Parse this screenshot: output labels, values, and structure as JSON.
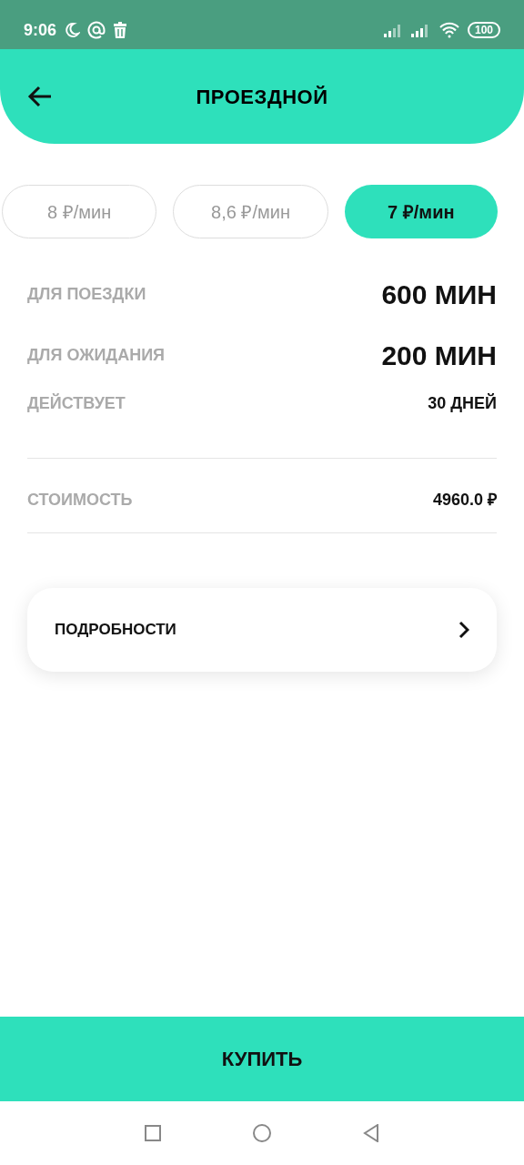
{
  "status_bar": {
    "time": "9:06",
    "battery": "100"
  },
  "header": {
    "title": "ПРОЕЗДНОЙ"
  },
  "tariffs": [
    {
      "label": "8 ₽/мин",
      "selected": false
    },
    {
      "label": "8,6 ₽/мин",
      "selected": false
    },
    {
      "label": "7 ₽/мин",
      "selected": true
    }
  ],
  "details": [
    {
      "label": "ДЛЯ ПОЕЗДКИ",
      "value": "600 МИН",
      "kind": "large"
    },
    {
      "label": "ДЛЯ ОЖИДАНИЯ",
      "value": "200 МИН",
      "kind": "large"
    },
    {
      "label": "ДЕЙСТВУЕТ",
      "value": "30 ДНЕЙ",
      "kind": "small"
    },
    {
      "label": "СТОИМОСТЬ",
      "value": "4960.0 ₽",
      "kind": "price"
    }
  ],
  "more_link": "ПОДРОБНОСТИ",
  "buy_button": "КУПИТЬ"
}
